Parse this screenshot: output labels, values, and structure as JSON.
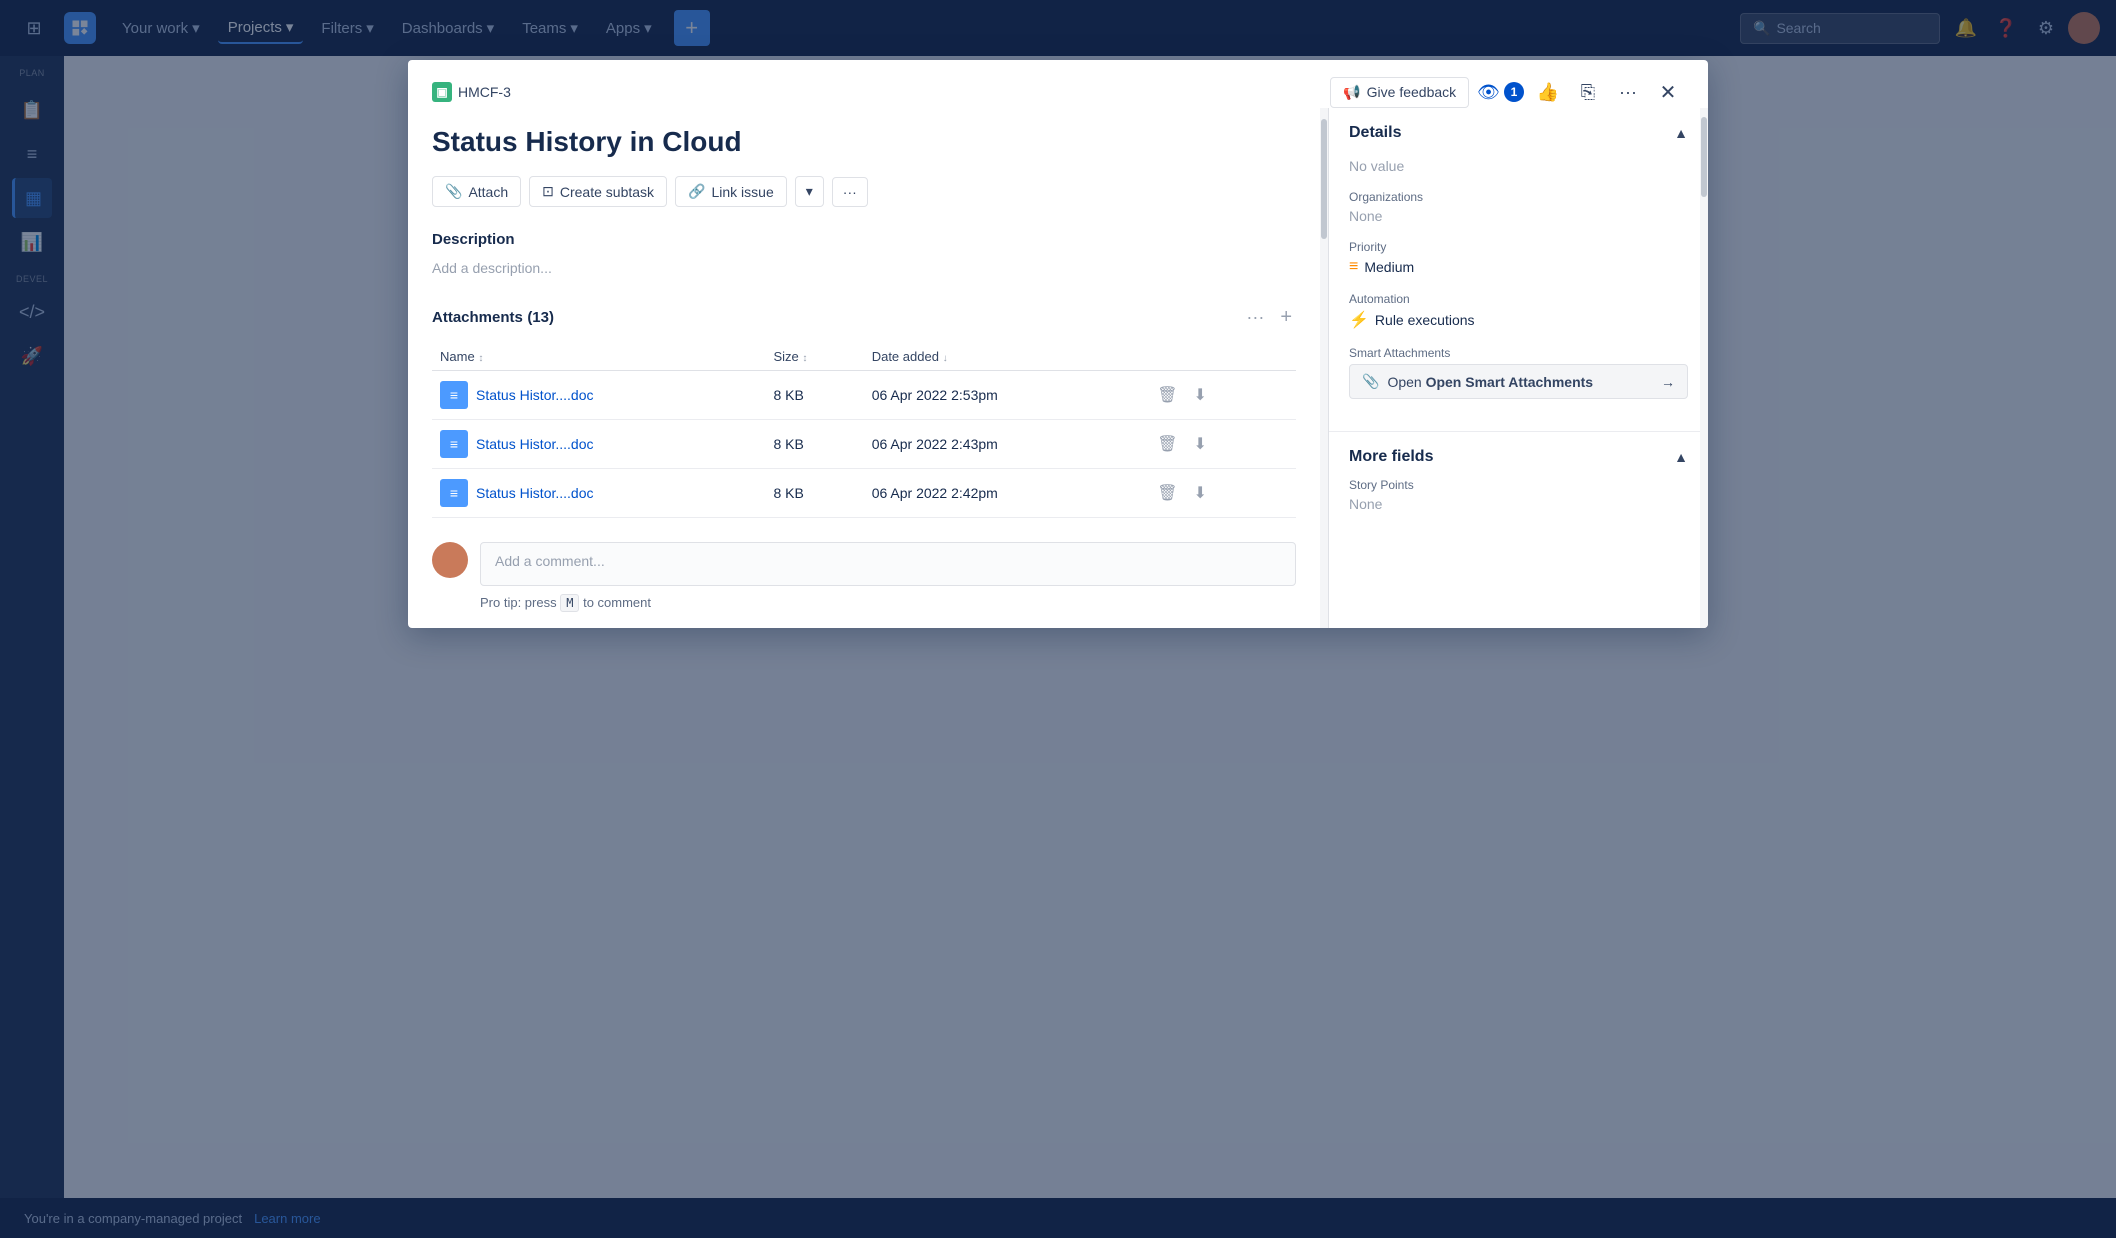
{
  "nav": {
    "items": [
      {
        "label": "Your work",
        "active": false
      },
      {
        "label": "Projects",
        "active": true
      },
      {
        "label": "Filters",
        "active": false
      },
      {
        "label": "Dashboards",
        "active": false
      },
      {
        "label": "Teams",
        "active": false
      },
      {
        "label": "Apps",
        "active": false
      }
    ],
    "search_placeholder": "Search",
    "plus_label": "+"
  },
  "modal": {
    "issue_id": "HMCF-3",
    "title": "Status History in Cloud",
    "feedback_label": "Give feedback",
    "watch_count": "1",
    "toolbar": {
      "attach": "Attach",
      "create_subtask": "Create subtask",
      "link_issue": "Link issue"
    },
    "description_section": "Description",
    "description_placeholder": "Add a description...",
    "attachments": {
      "title": "Attachments",
      "count": "(13)",
      "columns": {
        "name": "Name",
        "size": "Size",
        "date_added": "Date added"
      },
      "rows": [
        {
          "name": "Status Histor....doc",
          "size": "8 KB",
          "date": "06 Apr 2022 2:53pm"
        },
        {
          "name": "Status Histor....doc",
          "size": "8 KB",
          "date": "06 Apr 2022 2:43pm"
        },
        {
          "name": "Status Histor....doc",
          "size": "8 KB",
          "date": "06 Apr 2022 2:42pm"
        }
      ]
    },
    "comment": {
      "placeholder": "Add a comment...",
      "pro_tip": "Pro tip: press",
      "pro_tip_key": "M",
      "pro_tip_suffix": "to comment"
    }
  },
  "details": {
    "title": "Details",
    "no_value": "No value",
    "organizations_label": "Organizations",
    "organizations_value": "None",
    "priority_label": "Priority",
    "priority_value": "Medium",
    "automation_label": "Automation",
    "automation_value": "Rule executions",
    "smart_attachments_label": "Smart Attachments",
    "smart_attachments_btn": "Open Smart Attachments",
    "more_fields_title": "More fields",
    "story_points_label": "Story Points",
    "story_points_value": "None"
  },
  "bottom_bar": {
    "text": "You're in a company-managed project",
    "link": "Learn more"
  }
}
